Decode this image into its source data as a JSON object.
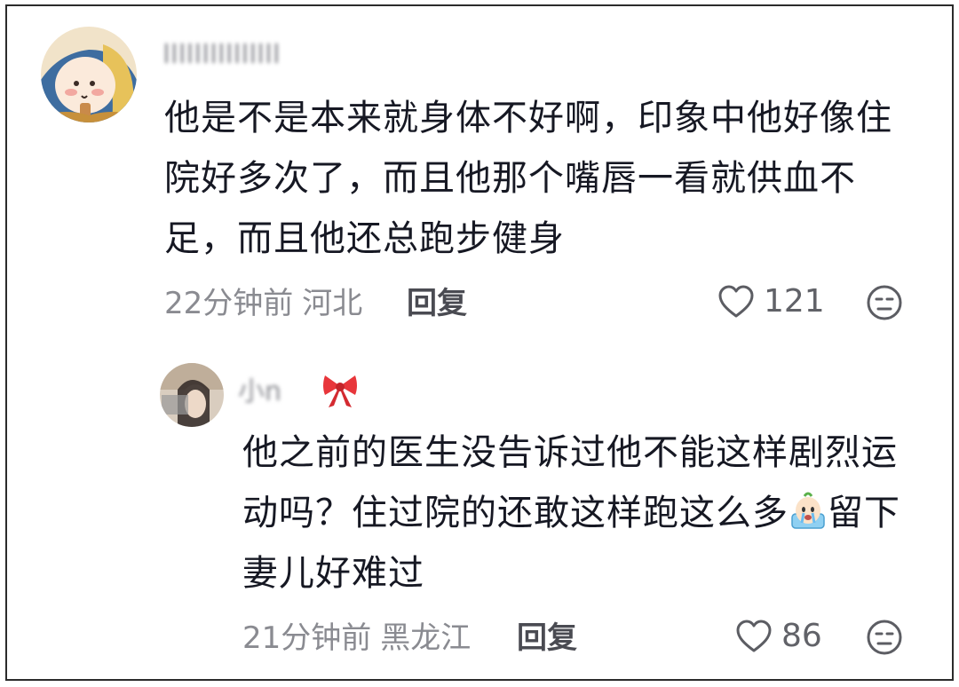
{
  "comments": [
    {
      "username": "IIIIIIIIIIIIIII",
      "text": "他是不是本来就身体不好啊，印象中他好像住院好多次了，而且他那个嘴唇一看就供血不足，而且他还总跑步健身",
      "time": "22分钟前",
      "location": "河北",
      "reply_label": "回复",
      "likes": "121",
      "icons": {
        "like": "heart-outline-icon",
        "dislike": "frown-face-icon"
      }
    },
    {
      "username": "小n",
      "badge_icon": "red-bow-icon",
      "text_before_emoji": "他之前的医生没告诉过他不能这样剧烈运动吗？住过院的还敢这样跑这么多",
      "emoji": "crying-emoji-icon",
      "text_after_emoji": "留下妻儿好难过",
      "time": "21分钟前",
      "location": "黑龙江",
      "reply_label": "回复",
      "likes": "86",
      "icons": {
        "like": "heart-outline-icon",
        "dislike": "frown-face-icon"
      }
    }
  ],
  "colors": {
    "text": "#161823",
    "meta": "#8a8b91",
    "reply": "#4a4b52",
    "border": "#2b2b2b"
  }
}
